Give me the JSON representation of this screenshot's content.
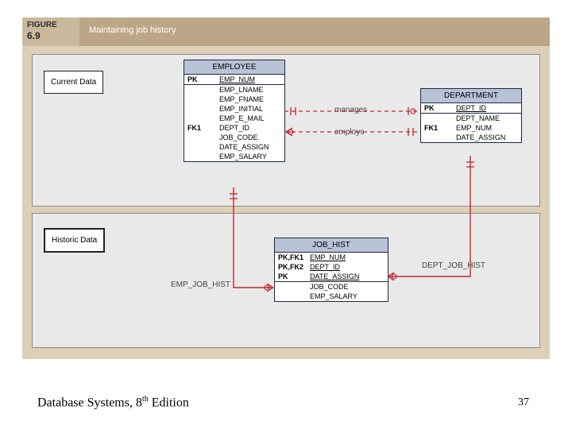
{
  "figure": {
    "label": "FIGURE",
    "number": "6.9",
    "title": "Maintaining job history"
  },
  "sections": {
    "current": "Current Data",
    "historic": "Historic Data"
  },
  "entities": {
    "employee": {
      "title": "EMPLOYEE",
      "pk_label": "PK",
      "pk_field": "EMP_NUM",
      "attrs": [
        "EMP_LNAME",
        "EMP_FNAME",
        "EMP_INITIAL",
        "EMP_E_MAIL"
      ],
      "fk1_label": "FK1",
      "fk1_field": "DEPT_ID",
      "attrs2": [
        "JOB_CODE",
        "DATE_ASSIGN",
        "EMP_SALARY"
      ]
    },
    "department": {
      "title": "DEPARTMENT",
      "pk_label": "PK",
      "pk_field": "DEPT_ID",
      "attr1": "DEPT_NAME",
      "fk1_label": "FK1",
      "fk1_field": "EMP_NUM",
      "attr2": "DATE_ASSIGN"
    },
    "job_hist": {
      "title": "JOB_HIST",
      "k1a": "PK,FK1",
      "k1b": "EMP_NUM",
      "k2a": "PK,FK2",
      "k2b": "DEPT_ID",
      "k3a": "PK",
      "k3b": "DATE_ASSIGN",
      "attr1": "JOB_CODE",
      "attr2": "EMP_SALARY"
    }
  },
  "relationships": {
    "manages": "manages",
    "employs": "employs",
    "emp_job_hist": "EMP_JOB_HIST",
    "dept_job_hist": "DEPT_JOB_HIST"
  },
  "footer": {
    "text_a": "Database Systems, 8",
    "text_sup": "th",
    "text_b": " Edition",
    "page": "37"
  }
}
